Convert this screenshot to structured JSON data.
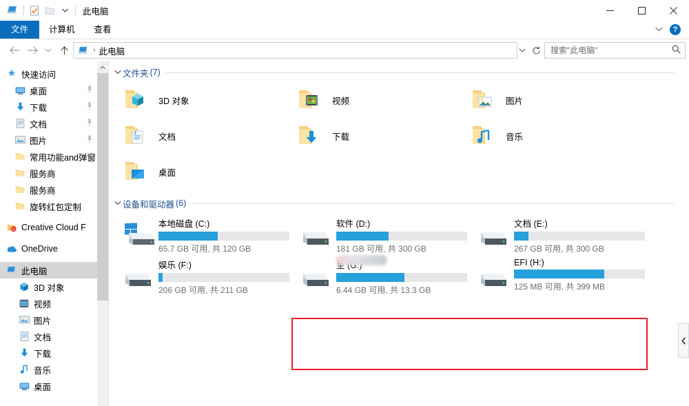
{
  "window": {
    "title": "此电脑",
    "quick_access": [
      {
        "name": "computer-icon",
        "glyph": "computer"
      },
      {
        "name": "properties-icon",
        "glyph": "checkbox"
      },
      {
        "name": "new-folder-icon",
        "glyph": "folder"
      },
      {
        "name": "customize-dropdown-icon",
        "glyph": "caret-down"
      }
    ],
    "controls": {
      "minimize": "—",
      "maximize": "□",
      "close": "✕"
    }
  },
  "ribbon": {
    "tabs": [
      {
        "label": "文件",
        "active": true
      },
      {
        "label": "计算机",
        "active": false
      },
      {
        "label": "查看",
        "active": false
      }
    ],
    "collapse_label": "ˇ",
    "help_label": "?"
  },
  "addressbar": {
    "back": "←",
    "forward": "→",
    "recent": "ˇ",
    "up": "↑",
    "crumb_icon": "computer-icon",
    "crumb": "此电脑",
    "separator": "›",
    "history_dropdown": "ˇ",
    "refresh": "↻"
  },
  "search": {
    "placeholder": "搜索\"此电脑\"",
    "value": "",
    "icon": "search-icon"
  },
  "sidebar": {
    "items": [
      {
        "label": "快速访问",
        "icon": "star-icon",
        "indent": 0,
        "pinned": false,
        "selected": false
      },
      {
        "label": "桌面",
        "icon": "desktop-icon",
        "indent": 1,
        "pinned": true,
        "selected": false
      },
      {
        "label": "下载",
        "icon": "download-icon",
        "indent": 1,
        "pinned": true,
        "selected": false
      },
      {
        "label": "文档",
        "icon": "documents-icon",
        "indent": 1,
        "pinned": true,
        "selected": false
      },
      {
        "label": "图片",
        "icon": "pictures-icon",
        "indent": 1,
        "pinned": true,
        "selected": false
      },
      {
        "label": "常用功能and弹窗",
        "icon": "folder-icon",
        "indent": 1,
        "pinned": false,
        "selected": false
      },
      {
        "label": "服务商",
        "icon": "folder-icon",
        "indent": 1,
        "pinned": false,
        "selected": false
      },
      {
        "label": "服务商",
        "icon": "folder-icon",
        "indent": 1,
        "pinned": false,
        "selected": false
      },
      {
        "label": "旋转红包定制",
        "icon": "folder-icon",
        "indent": 1,
        "pinned": false,
        "selected": false
      },
      {
        "label": "Creative Cloud F",
        "icon": "creative-cloud-icon",
        "indent": 0,
        "pinned": false,
        "selected": false
      },
      {
        "label": "OneDrive",
        "icon": "onedrive-icon",
        "indent": 0,
        "pinned": false,
        "selected": false
      },
      {
        "label": "此电脑",
        "icon": "computer-icon",
        "indent": 0,
        "pinned": false,
        "selected": true
      },
      {
        "label": "3D 对象",
        "icon": "3d-objects-icon",
        "indent": 1,
        "pinned": false,
        "selected": false
      },
      {
        "label": "视频",
        "icon": "videos-icon",
        "indent": 1,
        "pinned": false,
        "selected": false
      },
      {
        "label": "图片",
        "icon": "pictures-icon",
        "indent": 1,
        "pinned": false,
        "selected": false
      },
      {
        "label": "文档",
        "icon": "documents-icon",
        "indent": 1,
        "pinned": false,
        "selected": false
      },
      {
        "label": "下载",
        "icon": "download-icon",
        "indent": 1,
        "pinned": false,
        "selected": false
      },
      {
        "label": "音乐",
        "icon": "music-icon",
        "indent": 1,
        "pinned": false,
        "selected": false
      },
      {
        "label": "桌面",
        "icon": "desktop-icon",
        "indent": 1,
        "pinned": false,
        "selected": false
      }
    ]
  },
  "main": {
    "folders_group": {
      "chevron": "ˇ",
      "title": "文件夹",
      "count": "(7)",
      "items": [
        {
          "label": "3D 对象",
          "icon": "folder-3d-objects-icon"
        },
        {
          "label": "视频",
          "icon": "folder-videos-icon"
        },
        {
          "label": "图片",
          "icon": "folder-pictures-icon"
        },
        {
          "label": "文档",
          "icon": "folder-documents-icon"
        },
        {
          "label": "下载",
          "icon": "folder-downloads-icon"
        },
        {
          "label": "音乐",
          "icon": "folder-music-icon"
        },
        {
          "label": "桌面",
          "icon": "folder-desktop-icon"
        }
      ]
    },
    "drives_group": {
      "chevron": "ˇ",
      "title": "设备和驱动器",
      "count": "(6)",
      "items": [
        {
          "name": "本地磁盘 (C:)",
          "free_text": "65.7 GB 可用, 共 120 GB",
          "used_percent": 45,
          "icon": "windows-drive-icon",
          "redacted": false,
          "highlighted": false
        },
        {
          "name": "软件 (D:)",
          "free_text": "181 GB 可用, 共 300 GB",
          "used_percent": 40,
          "icon": "drive-icon",
          "redacted": false,
          "highlighted": false
        },
        {
          "name": "文档 (E:)",
          "free_text": "267 GB 可用, 共 300 GB",
          "used_percent": 11,
          "icon": "drive-icon",
          "redacted": false,
          "highlighted": false
        },
        {
          "name": "娱乐 (F:)",
          "free_text": "206 GB 可用, 共 211 GB",
          "used_percent": 3,
          "icon": "drive-icon",
          "redacted": false,
          "highlighted": false
        },
        {
          "name": "至 (G:)",
          "free_text": "6.44 GB 可用, 共 13.3 GB",
          "used_percent": 52,
          "icon": "drive-icon",
          "redacted": true,
          "highlighted": true
        },
        {
          "name": "EFI (H:)",
          "free_text": "125 MB 可用, 共 399 MB",
          "used_percent": 69,
          "icon": "drive-icon",
          "redacted": false,
          "highlighted": true
        }
      ]
    }
  },
  "annotation": {
    "color": "#ee1c25",
    "shape": "rectangle"
  },
  "collapse_handle": {
    "label": "‹",
    "name": "preview-pane-collapse"
  },
  "colors": {
    "accent": "#0b6ebd",
    "drive_bar": "#26a0da",
    "group_title": "#1a4f8f",
    "annotation": "#ee1c25"
  }
}
